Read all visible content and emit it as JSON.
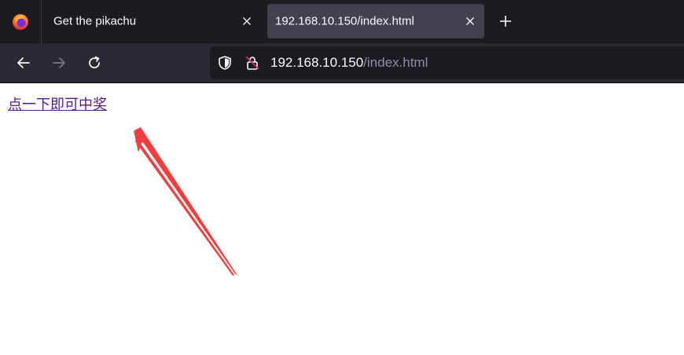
{
  "browser": {
    "tabs": [
      {
        "title": "Get the pikachu",
        "active": false
      },
      {
        "title": "192.168.10.150/index.html",
        "active": true
      }
    ],
    "new_tab_icon": "plus-icon",
    "url": {
      "host": "192.168.10.150",
      "path": "/index.html"
    },
    "colors": {
      "tabstrip_bg": "#1c1b22",
      "active_tab_bg": "#42414d",
      "toolbar_bg": "#2b2a33",
      "visited_link": "#551a8b",
      "annotation_arrow": "#ef3e3e"
    }
  },
  "page": {
    "link_text": "点一下即可中奖"
  }
}
